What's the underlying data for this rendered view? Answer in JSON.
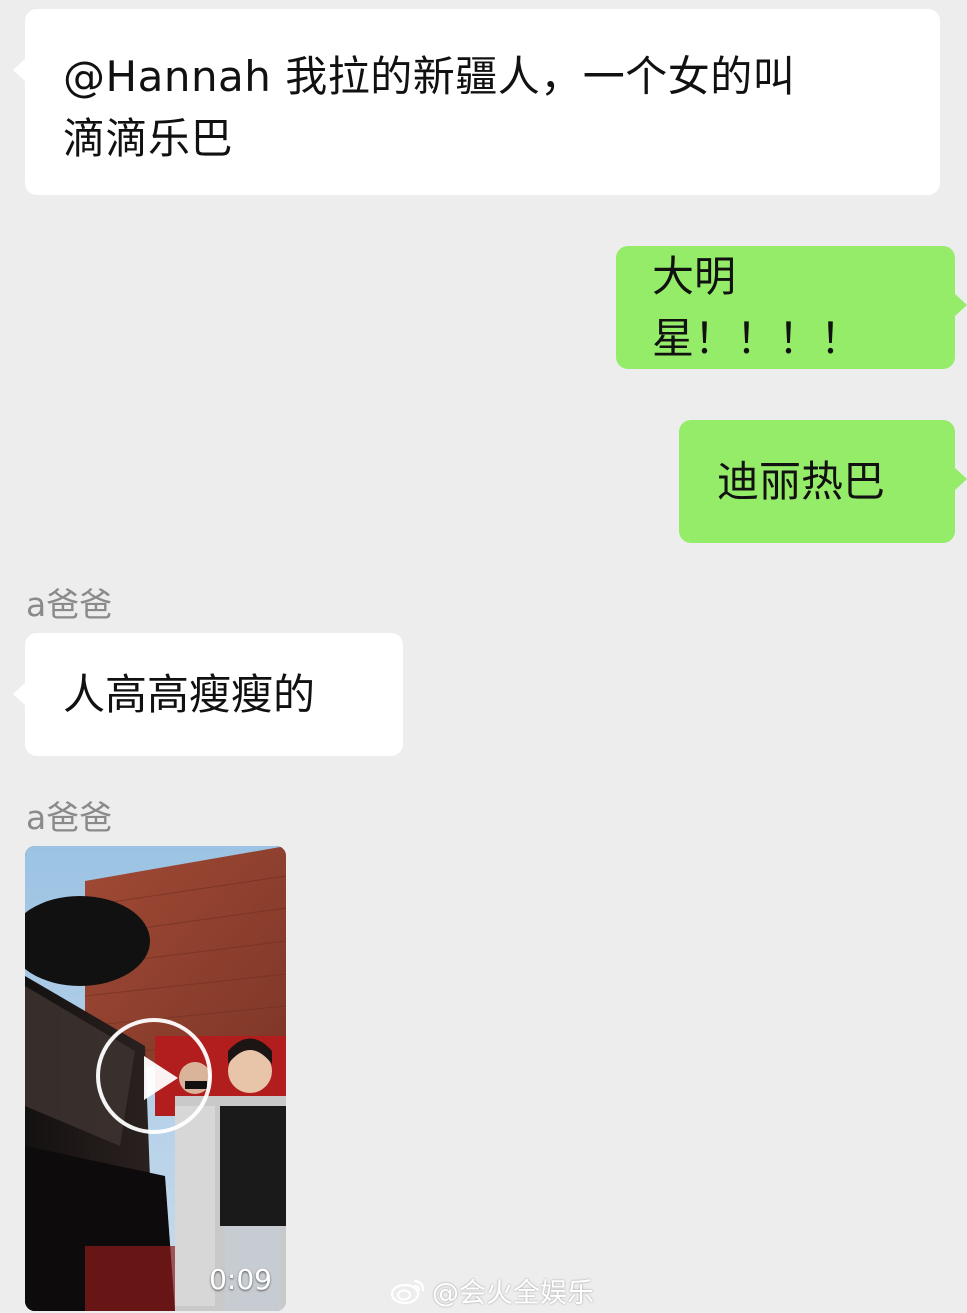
{
  "messages": [
    {
      "side": "left",
      "text_line1": "@Hannah 我拉的新疆人，一个女的叫",
      "text_line2": "滴滴乐巴"
    },
    {
      "side": "right",
      "text": "大明星！！！！"
    },
    {
      "side": "right",
      "text": "迪丽热巴"
    },
    {
      "side": "left",
      "sender": "a爸爸",
      "text": "人高高瘦瘦的"
    },
    {
      "side": "left",
      "sender": "a爸爸",
      "type": "video",
      "duration": "0:09"
    }
  ],
  "watermark": {
    "text": "@会火全娱乐",
    "icon": "weibo-logo-icon"
  },
  "colors": {
    "background": "#ededed",
    "incoming_bubble": "#ffffff",
    "outgoing_bubble": "#95ec69",
    "sender_name": "#8a8a8a"
  }
}
